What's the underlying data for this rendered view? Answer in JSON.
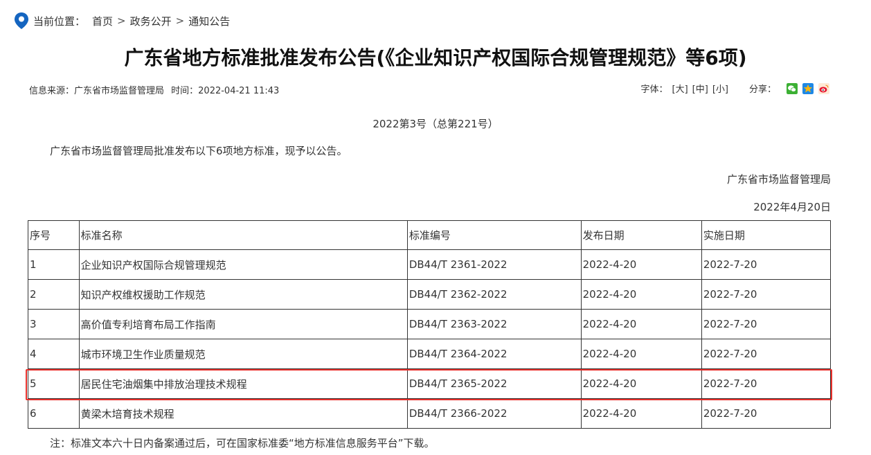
{
  "breadcrumb": {
    "label": "当前位置：",
    "items": [
      "首页",
      "政务公开",
      "通知公告"
    ],
    "separator": ">"
  },
  "title": "广东省地方标准批准发布公告(《企业知识产权国际合规管理规范》等6项)",
  "meta": {
    "source": "信息来源：广东省市场监督管理局",
    "time": "时间：2022-04-21 11:43"
  },
  "tools": {
    "font_label": "字体：",
    "font_sizes": [
      "[大]",
      "[中]",
      "[小]"
    ],
    "share_label": "分享：",
    "share_icons": [
      "wechat-icon",
      "qzone-icon",
      "weibo-icon"
    ]
  },
  "issue_number": "2022第3号（总第221号）",
  "intro": "广东省市场监督管理局批准发布以下6项地方标准，现予以公告。",
  "signer": "广东省市场监督管理局",
  "sign_date": "2022年4月20日",
  "table": {
    "headers": [
      "序号",
      "标准名称",
      "标准编号",
      "发布日期",
      "实施日期"
    ],
    "rows": [
      [
        "1",
        "企业知识产权国际合规管理规范",
        "DB44/T 2361-2022",
        "2022-4-20",
        "2022-7-20"
      ],
      [
        "2",
        "知识产权维权援助工作规范",
        "DB44/T 2362-2022",
        "2022-4-20",
        "2022-7-20"
      ],
      [
        "3",
        "高价值专利培育布局工作指南",
        "DB44/T 2363-2022",
        "2022-4-20",
        "2022-7-20"
      ],
      [
        "4",
        "城市环境卫生作业质量规范",
        "DB44/T 2364-2022",
        "2022-4-20",
        "2022-7-20"
      ],
      [
        "5",
        "居民住宅油烟集中排放治理技术规程",
        "DB44/T 2365-2022",
        "2022-4-20",
        "2022-7-20"
      ],
      [
        "6",
        "黄梁木培育技术规程",
        "DB44/T 2366-2022",
        "2022-4-20",
        "2022-7-20"
      ]
    ],
    "highlighted_row": "5"
  },
  "note": "注：标准文本六十日内备案通过后，可在国家标准委“地方标准信息服务平台”下载。",
  "colors": {
    "pin": "#1565c0",
    "highlight": "#e8302b",
    "wechat": "#3cb034",
    "qzone": "#f6b50e",
    "weibo": "#e6162d"
  }
}
